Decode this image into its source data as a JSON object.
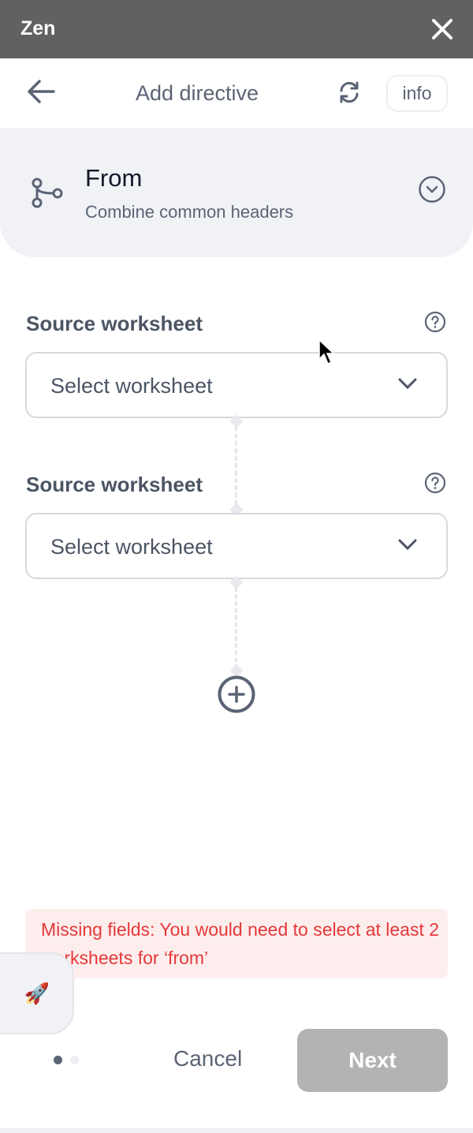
{
  "topbar": {
    "title": "Zen"
  },
  "header": {
    "title": "Add directive",
    "info_label": "info"
  },
  "directive": {
    "title": "From",
    "subtitle": "Combine common headers"
  },
  "fields": [
    {
      "label": "Source worksheet",
      "placeholder": "Select worksheet"
    },
    {
      "label": "Source worksheet",
      "placeholder": "Select worksheet"
    }
  ],
  "error": {
    "message": "Missing fields: You would need to select at least 2 worksheets for ‘from’"
  },
  "rocket": {
    "icon": "🚀"
  },
  "footer": {
    "cancel_label": "Cancel",
    "next_label": "Next",
    "steps_total": 2,
    "current_step": 1
  },
  "colors": {
    "error_text": "#e5383b",
    "error_bg": "#fdeeed",
    "disabled_button": "#b3b3b3",
    "topbar": "#616161"
  }
}
